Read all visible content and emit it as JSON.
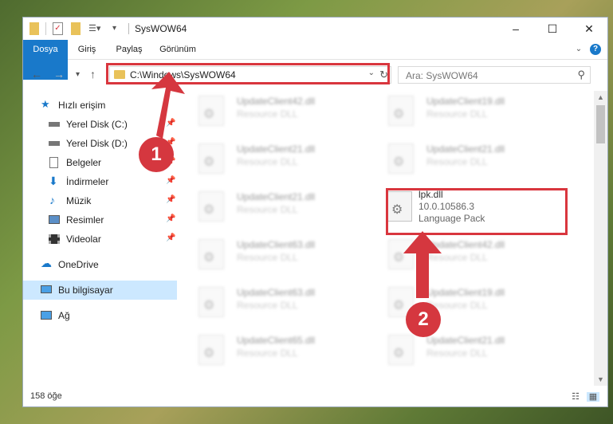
{
  "window": {
    "title": "SysWOW64"
  },
  "ribbon": {
    "tabs": [
      "Dosya",
      "Giriş",
      "Paylaş",
      "Görünüm"
    ]
  },
  "nav": {
    "address": "C:\\Windows\\SysWOW64",
    "search_placeholder": "Ara: SysWOW64"
  },
  "sidebar": {
    "quick_access": "Hızlı erişim",
    "items": [
      "Yerel Disk (C:)",
      "Yerel Disk (D:)",
      "Belgeler",
      "İndirmeler",
      "Müzik",
      "Resimler",
      "Videolar"
    ],
    "onedrive": "OneDrive",
    "this_pc": "Bu bilgisayar",
    "network": "Ağ"
  },
  "files": {
    "left": [
      {
        "name": "UpdateClient42.dll",
        "desc": "Resource DLL"
      },
      {
        "name": "UpdateClient21.dll",
        "desc": "Resource DLL"
      },
      {
        "name": "UpdateClient21.dll",
        "desc": "Resource DLL"
      },
      {
        "name": "UpdateClient63.dll",
        "desc": "Resource DLL"
      },
      {
        "name": "UpdateClient63.dll",
        "desc": "Resource DLL"
      },
      {
        "name": "UpdateClient65.dll",
        "desc": "Resource DLL"
      }
    ],
    "right": [
      {
        "name": "UpdateClient19.dll",
        "desc": "Resource DLL"
      },
      {
        "name": "UpdateClient21.dll",
        "desc": "Resource DLL"
      },
      {
        "name": "UpdateClient42.dll",
        "desc": "Resource DLL"
      },
      {
        "name": "UpdateClient19.dll",
        "desc": "Resource DLL"
      },
      {
        "name": "UpdateClient21.dll",
        "desc": "Resource DLL"
      }
    ],
    "highlighted": {
      "name": "lpk.dll",
      "version": "10.0.10586.3",
      "desc": "Language Pack"
    }
  },
  "status": {
    "count": "158 öğe"
  },
  "annotations": {
    "one": "1",
    "two": "2"
  },
  "colors": {
    "accent": "#1979ca",
    "highlight": "#d9363e",
    "selected": "#cce8ff"
  }
}
